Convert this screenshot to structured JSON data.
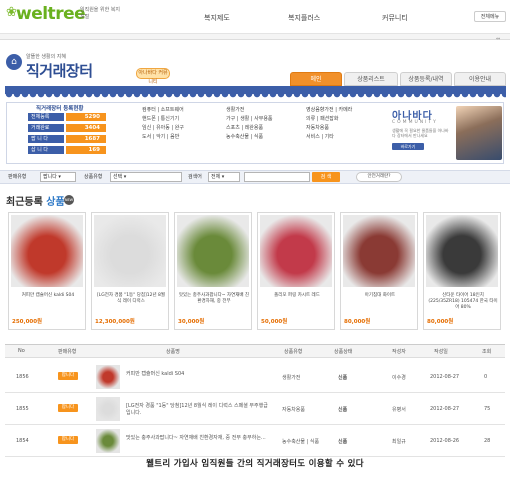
{
  "header": {
    "logo_text": "weltree",
    "logo_sub": "임직원을 위한 복지포털",
    "nav": [
      "복지제도",
      "복지플러스",
      "커뮤니티"
    ],
    "lang_button": "전체메뉴"
  },
  "market": {
    "subtitle": "알뜰한 생활의 지혜",
    "title": "직거래장터",
    "badge": "아나바다 커뮤니티",
    "tabs": [
      "메인",
      "상품리스트",
      "상품등록/내역",
      "이용안내"
    ]
  },
  "stats": {
    "title": "직거래장터 등록현황",
    "rows": [
      {
        "label": "전체등록",
        "value": "5290"
      },
      {
        "label": "거래완료",
        "value": "3404"
      },
      {
        "label": "팝 니 다",
        "value": "1687"
      },
      {
        "label": "삽 니 다",
        "value": "169"
      }
    ],
    "categories_col1": [
      "컴퓨터 | 소프트웨어",
      "핸드폰 | 통신기기",
      "임신 | 유아동 | 완구",
      "도서 | 악기 | 음반"
    ],
    "categories_col2": [
      "생활가전",
      "가구 | 생활 | 사무용품",
      "스포츠 | 레완용품",
      "농수축산물 | 식품"
    ],
    "categories_col3": [
      "영상음향가전 | 카메라",
      "의류 | 패션잡화",
      "자동차용품",
      "서비스 | 기타"
    ]
  },
  "anabada": {
    "brand": "아나바다",
    "community": "COMMUNITY",
    "desc": "생활에 꼭 필요한 물품들을 아나바다 장터에서 만나세요",
    "button": "바로가기"
  },
  "search": {
    "type_label": "판매유형",
    "type_value": "팝니다",
    "category_label": "상품유형",
    "category_value": "선택",
    "keyword_label": "검색어",
    "keyword_scope": "전체",
    "search_button": "검 색",
    "safe_button": "안전거래란?"
  },
  "recent": {
    "title_plain": "최근등록",
    "title_accent": "상품",
    "new_badge": "NEW",
    "products": [
      {
        "name": "커피만 캡슐머신 kaldi S04",
        "price": "250,000원",
        "color": "#c0392b"
      },
      {
        "name": "[LG전자 경품 \"1등\" 당첨]12년 8월식 레이 디럭스",
        "price": "12,300,000원",
        "color": "#dcdcdc"
      },
      {
        "name": "맛있는 충주사과팝니다~ 자연재배 친환경자재, 중 전부",
        "price": "30,000원",
        "color": "#6a8a3a"
      },
      {
        "name": "폴리모 퍼링 카시트 레드",
        "price": "50,000원",
        "color": "#c23a4a"
      },
      {
        "name": "아기침대 화이트",
        "price": "80,000원",
        "color": "#8a3a34"
      },
      {
        "name": "신타운 타이어 18인치(225/35ZR18) 105474 한국 타이어 80%",
        "price": "80,000원",
        "color": "#3a3a3a"
      }
    ]
  },
  "table": {
    "headers": [
      "No",
      "판매유형",
      "상품명",
      "상품유형",
      "상품상태",
      "작성자",
      "작성일",
      "조회"
    ],
    "rows": [
      {
        "no": "1856",
        "type": "팝니다",
        "name": "커피만 캡슐머신 kaldi S04",
        "category": "생활가전",
        "state": "신품",
        "author": "이수경",
        "date": "2012-08-27",
        "views": "0"
      },
      {
        "no": "1855",
        "type": "팝니다",
        "name": "[LG전자 경품 \"1등\" 당첨]12년 8월식 레이 디럭스 스페셜 무주행급입니다.",
        "category": "자동차용품",
        "state": "신품",
        "author": "유병서",
        "date": "2012-08-27",
        "views": "75"
      },
      {
        "no": "1854",
        "type": "팝니다",
        "name": "맛있는 충주사과팝니다~ 자연재배 친환경자재, 중 전부 충무하는...",
        "category": "농수축산물 | 식품",
        "state": "신품",
        "author": "최일규",
        "date": "2012-08-26",
        "views": "28"
      }
    ]
  },
  "caption": "웰트리 가입사 임직원들 간의 직거래장터도 이용할 수 있다"
}
